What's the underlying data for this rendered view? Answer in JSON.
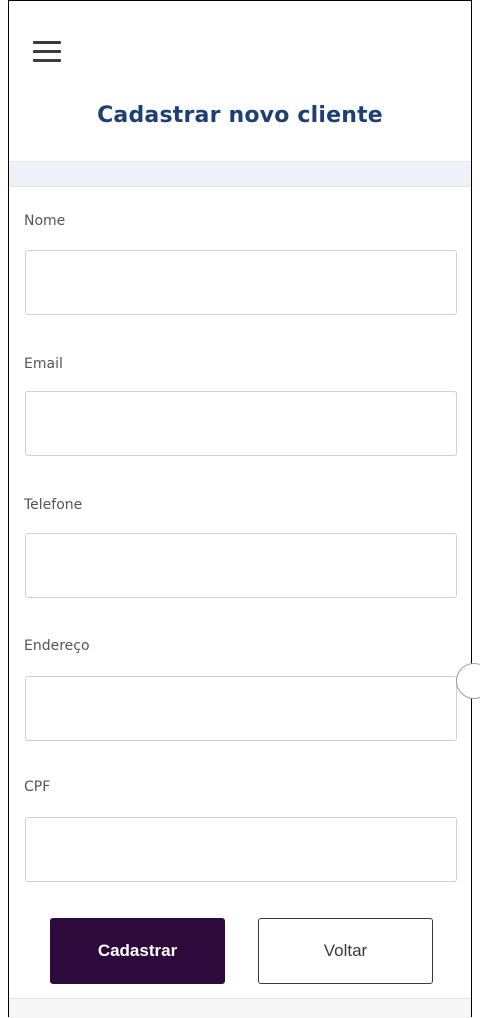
{
  "header": {
    "title": "Cadastrar novo cliente",
    "menu_icon": "hamburger-menu-icon"
  },
  "form": {
    "fields": [
      {
        "label": "Nome",
        "value": "",
        "placeholder": ""
      },
      {
        "label": "Email",
        "value": "",
        "placeholder": ""
      },
      {
        "label": "Telefone",
        "value": "",
        "placeholder": ""
      },
      {
        "label": "Endereço",
        "value": "",
        "placeholder": ""
      },
      {
        "label": "CPF",
        "value": "",
        "placeholder": ""
      }
    ]
  },
  "actions": {
    "submit_label": "Cadastrar",
    "back_label": "Voltar"
  },
  "colors": {
    "title": "#1d3f73",
    "primary_button": "#2d0a3c",
    "band": "#eef2f8"
  }
}
